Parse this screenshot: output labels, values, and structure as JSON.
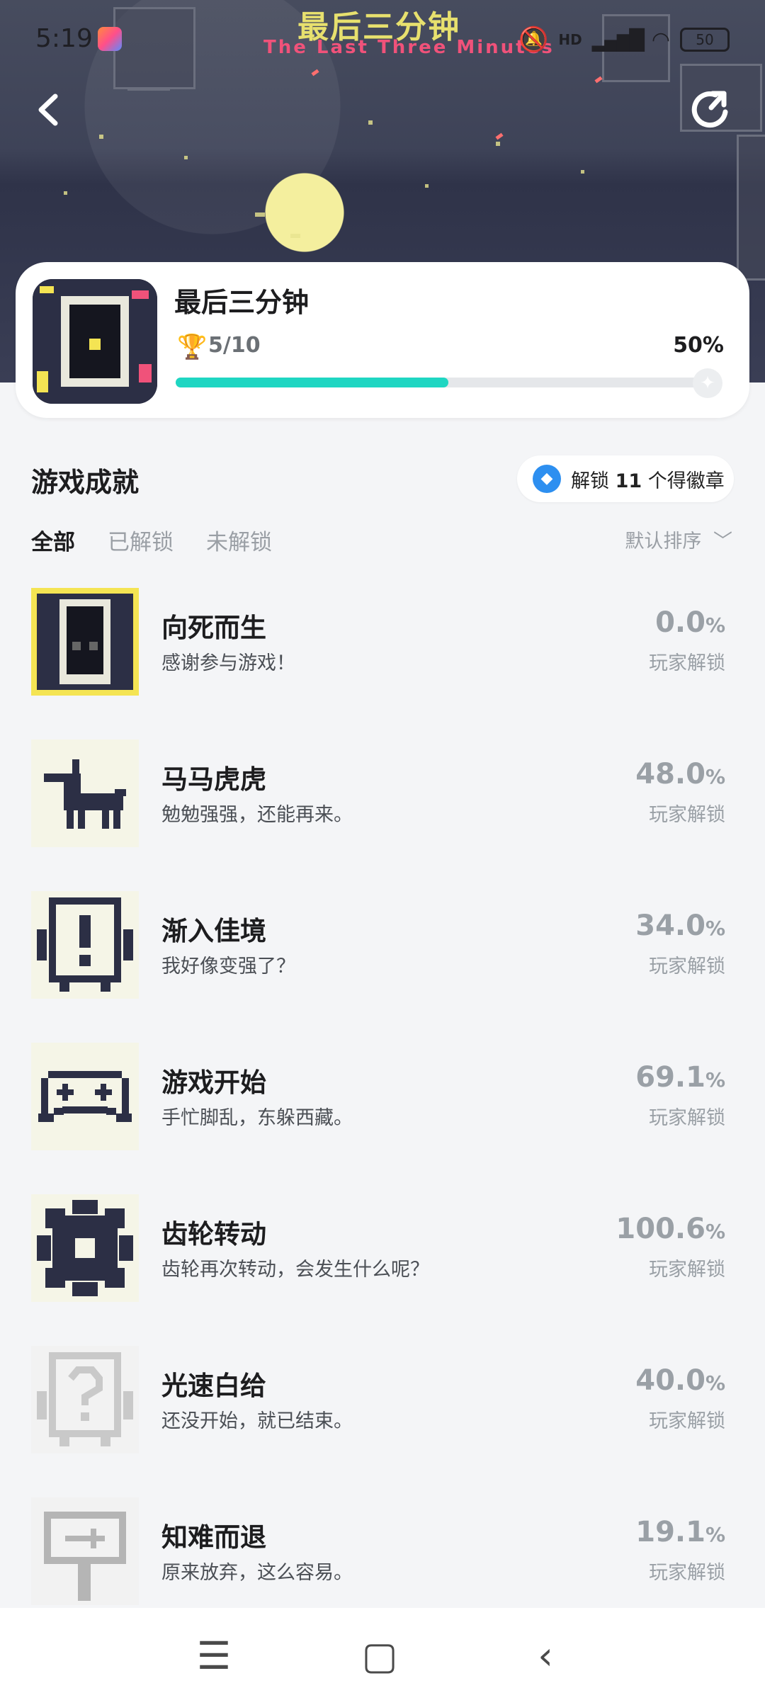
{
  "status_bar": {
    "time": "5:19",
    "network": "HD",
    "battery": "50"
  },
  "hero": {
    "art_title": "最后三分钟",
    "art_subtitle": "The Last Three Minutes"
  },
  "nav": {
    "back_icon": "back-arrow-icon",
    "share_icon": "share-icon"
  },
  "game": {
    "name": "最后三分钟",
    "unlocked": "5/10",
    "percent": "50%",
    "progress": 0.5
  },
  "section": {
    "title": "游戏成就",
    "badge_prefix": "解锁 ",
    "badge_count": "11",
    "badge_suffix": " 个得徽章"
  },
  "tabs": [
    "全部",
    "已解锁",
    "未解锁"
  ],
  "sort_label": "默认排序",
  "achievements": [
    {
      "title": "向死而生",
      "desc": "感谢参与游戏！",
      "value": "0.0",
      "unit": "%",
      "label": "玩家解锁",
      "icon": "robot-face-icon"
    },
    {
      "title": "马马虎虎",
      "desc": "勉勉强强，还能再来。",
      "value": "48.0",
      "unit": "%",
      "label": "玩家解锁",
      "icon": "horse-icon"
    },
    {
      "title": "渐入佳境",
      "desc": "我好像变强了？",
      "value": "34.0",
      "unit": "%",
      "label": "玩家解锁",
      "icon": "exclamation-robot-icon"
    },
    {
      "title": "游戏开始",
      "desc": "手忙脚乱，东躲西藏。",
      "value": "69.1",
      "unit": "%",
      "label": "玩家解锁",
      "icon": "gamepad-icon"
    },
    {
      "title": "齿轮转动",
      "desc": "齿轮再次转动，会发生什么呢？",
      "value": "100.6",
      "unit": "%",
      "label": "玩家解锁",
      "icon": "gear-icon"
    },
    {
      "title": "光速白给",
      "desc": "还没开始，就已结束。",
      "value": "40.0",
      "unit": "%",
      "label": "玩家解锁",
      "icon": "question-robot-icon"
    },
    {
      "title": "知难而退",
      "desc": "原来放弃，这么容易。",
      "value": "19.1",
      "unit": "%",
      "label": "玩家解锁",
      "icon": "sign-icon"
    }
  ]
}
